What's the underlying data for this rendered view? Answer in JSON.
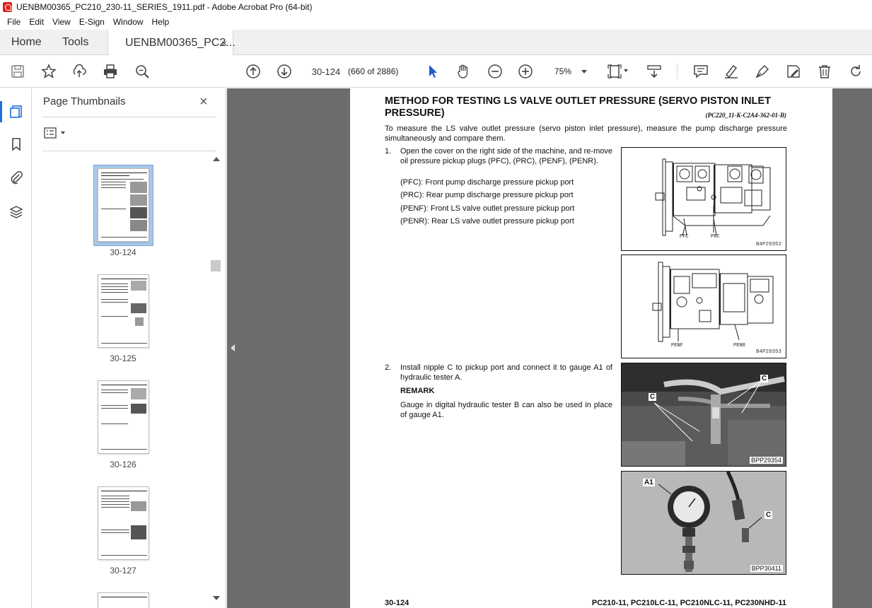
{
  "window": {
    "title": "UENBM00365_PC210_230-11_SERIES_1911.pdf - Adobe Acrobat Pro (64-bit)"
  },
  "menu": [
    "File",
    "Edit",
    "View",
    "E-Sign",
    "Window",
    "Help"
  ],
  "tabs": {
    "home": "Home",
    "tools": "Tools",
    "document": "UENBM00365_PC2...",
    "close": "×"
  },
  "toolbar": {
    "page_number": "30-124",
    "page_count": "(660 of 2886)",
    "zoom": "75%",
    "icons": [
      "save-icon",
      "star-icon",
      "share-icon",
      "print-icon",
      "zoom-search-icon",
      "page-up-icon",
      "page-down-icon",
      "select-cursor-icon",
      "hand-icon",
      "zoom-out-icon",
      "zoom-in-icon",
      "fit-page-icon",
      "scroll-mode-icon",
      "comment-icon",
      "highlight-icon",
      "sign-icon",
      "fill-sign-icon",
      "delete-icon",
      "rotate-icon"
    ]
  },
  "sidebar": {
    "title": "Page Thumbnails",
    "close": "×",
    "thumbnails": [
      {
        "label": "30-124",
        "selected": true
      },
      {
        "label": "30-125",
        "selected": false
      },
      {
        "label": "30-126",
        "selected": false
      },
      {
        "label": "30-127",
        "selected": false
      }
    ]
  },
  "document": {
    "title": "METHOD FOR TESTING LS VALVE OUTLET PRESSURE (SERVO PISTON INLET PRESSURE)",
    "code": "(PC220_11-K-C2A4-362-01-B)",
    "intro": "To measure the LS valve outlet pressure (servo piston inlet pressure), measure the pump discharge pressure simultaneously and compare them.",
    "step1": {
      "num": "1.",
      "text": "Open the cover on the right side of the machine, and re-move oil pressure pickup plugs (PFC), (PRC), (PENF), (PENR).",
      "items": [
        "(PFC): Front pump discharge pressure pickup port",
        "(PRC): Rear pump discharge pressure pickup port",
        "(PENF): Front LS valve outlet pressure pickup port",
        "(PENR): Rear LS valve outlet pressure pickup port"
      ]
    },
    "step2": {
      "num": "2.",
      "text": "Install nipple C to pickup port and connect it to gauge A1 of hydraulic tester A.",
      "remark_title": "REMARK",
      "remark_text": "Gauge in digital hydraulic tester B can also be used in place of gauge A1."
    },
    "figures": {
      "fig1": {
        "code": "B4P29352",
        "labels": [
          "PFC",
          "PRC"
        ]
      },
      "fig2": {
        "code": "B4P29353",
        "labels": [
          "PENF",
          "PENR"
        ]
      },
      "fig3": {
        "code": "BPP29354",
        "labels": [
          "C",
          "C"
        ]
      },
      "fig4": {
        "code": "BPP30411",
        "labels": [
          "A1",
          "C"
        ]
      }
    },
    "footer_left": "30-124",
    "footer_right": "PC210-11, PC210LC-11, PC210NLC-11, PC230NHD-11"
  }
}
